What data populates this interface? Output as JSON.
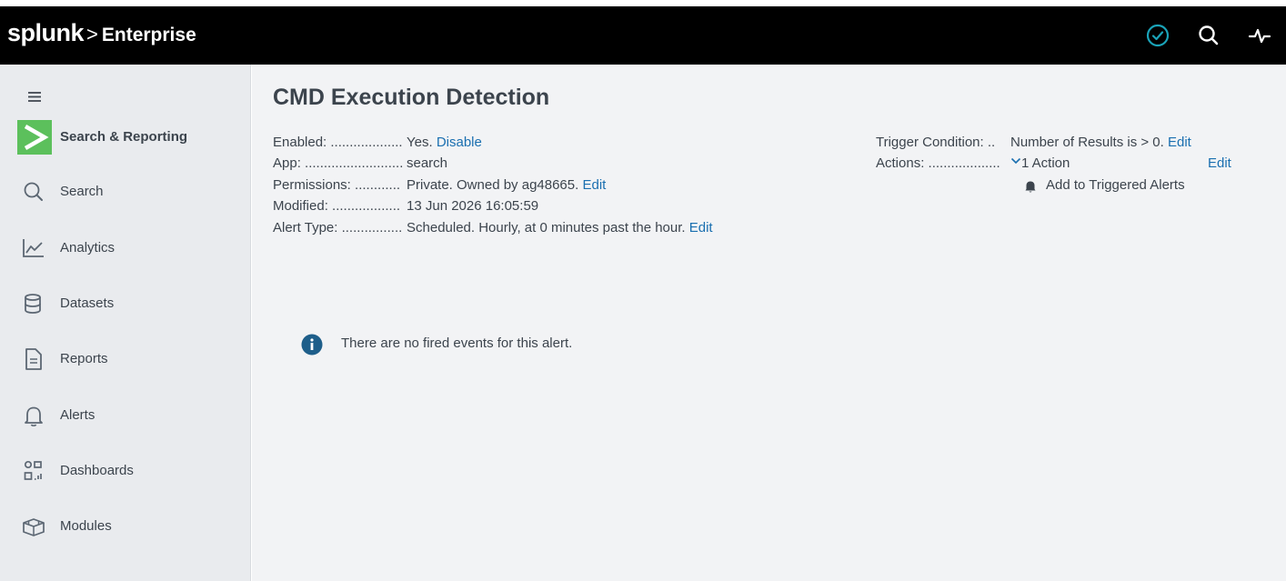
{
  "header": {
    "logo": "splunk",
    "separator": ">",
    "product": "Enterprise",
    "icons": [
      "check-circle-icon",
      "search-icon",
      "activity-icon"
    ]
  },
  "sidebar": {
    "menu_icon": "hamburger-icon",
    "app": {
      "name": "Search & Reporting",
      "icon": "chevron-right-logo"
    },
    "items": [
      {
        "label": "Search",
        "icon": "search-icon"
      },
      {
        "label": "Analytics",
        "icon": "line-chart-icon"
      },
      {
        "label": "Datasets",
        "icon": "database-icon"
      },
      {
        "label": "Reports",
        "icon": "document-icon"
      },
      {
        "label": "Alerts",
        "icon": "bell-icon"
      },
      {
        "label": "Dashboards",
        "icon": "dashboard-icon"
      },
      {
        "label": "Modules",
        "icon": "modules-icon"
      }
    ]
  },
  "alert": {
    "title": "CMD Execution Detection",
    "enabled": {
      "label": "Enabled: ...................",
      "value": "Yes.",
      "link": "Disable"
    },
    "app": {
      "label": "App: ..........................",
      "value": "search"
    },
    "permissions": {
      "label": "Permissions: ............",
      "value": "Private. Owned by ag48665.",
      "link": "Edit"
    },
    "modified": {
      "label": "Modified: ..................",
      "value": "13 Jun 2026 16:05:59"
    },
    "alert_type": {
      "label": "Alert Type: ................",
      "value": "Scheduled. Hourly, at 0 minutes past the hour.",
      "link": "Edit"
    },
    "trigger_condition": {
      "label": "Trigger Condition: ..",
      "value": "Number of Results is > 0.",
      "link": "Edit"
    },
    "actions": {
      "label": "Actions: ...................",
      "value": "1 Action",
      "link": "Edit",
      "items": [
        "Add to Triggered Alerts"
      ]
    },
    "empty_message": "There are no fired events for this alert."
  },
  "colors": {
    "topbar": "#000000",
    "accent_green": "#5cc05c",
    "link": "#1a6fb0",
    "check_teal": "#1aa3b8",
    "info_blue": "#1e5e8a",
    "sidebar_bg": "#e9ebee",
    "main_bg": "#f2f3f5"
  }
}
